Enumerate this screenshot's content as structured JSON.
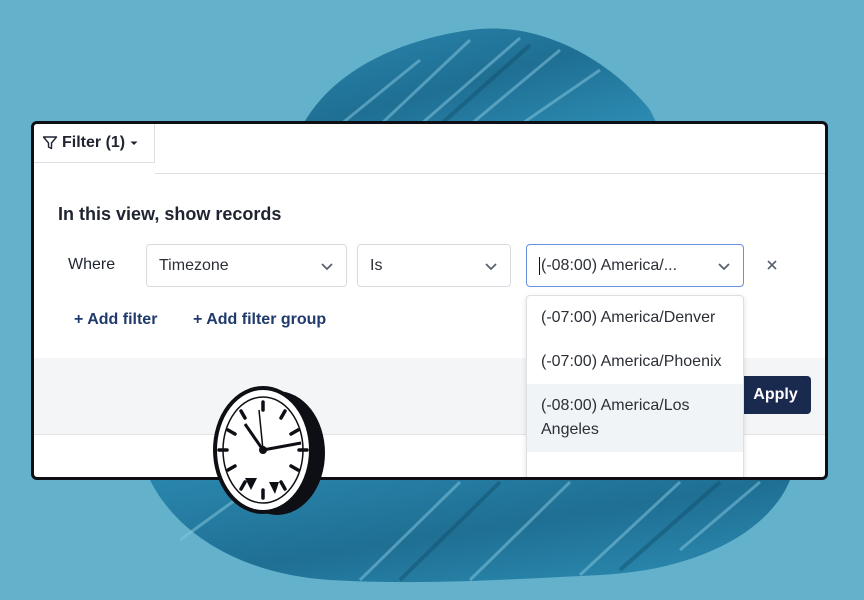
{
  "filter_tab": {
    "label": "Filter (1)"
  },
  "heading": "In this view, show records",
  "where_label": "Where",
  "condition": {
    "field": "Timezone",
    "operator": "Is",
    "value": "(-08:00) America/..."
  },
  "actions": {
    "add_filter": "+ Add filter",
    "add_filter_group": "+ Add filter group",
    "apply": "Apply"
  },
  "dropdown": {
    "options": [
      {
        "label": "(-07:00) America/Denver"
      },
      {
        "label": "(-07:00) America/Phoenix"
      },
      {
        "label": "(-08:00) America/Los Angeles",
        "highlighted": true
      }
    ]
  },
  "icons": [
    "filter-icon",
    "caret-down-icon",
    "chevron-down-icon",
    "close-icon",
    "clock-illustration"
  ],
  "colors": {
    "background": "#63b1ca",
    "brush": "#1f6f93",
    "panel_border": "#0d0f14",
    "apply_button": "#1a2a4f",
    "link": "#1f3a6b"
  }
}
